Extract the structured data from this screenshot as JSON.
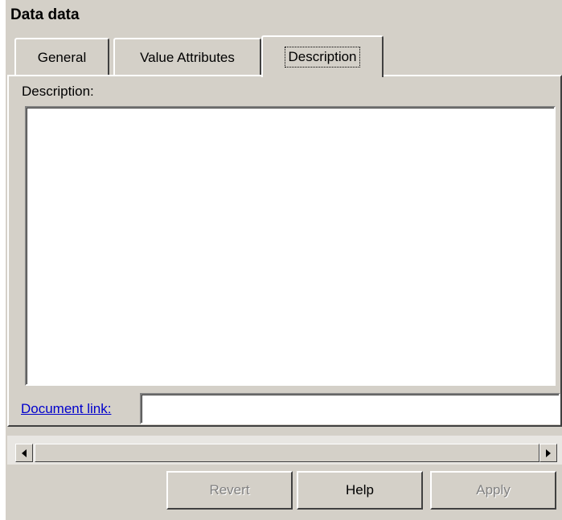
{
  "dialog": {
    "title": "Data data"
  },
  "tabs": [
    {
      "label": "General",
      "active": false
    },
    {
      "label": "Value Attributes",
      "active": false
    },
    {
      "label": "Description",
      "active": true
    }
  ],
  "description": {
    "label": "Description:",
    "value": ""
  },
  "document_link": {
    "label": "Document link:",
    "value": ""
  },
  "buttons": {
    "revert": {
      "label": "Revert",
      "enabled": false
    },
    "help": {
      "label": "Help",
      "enabled": true
    },
    "apply": {
      "label": "Apply",
      "enabled": false
    }
  },
  "colors": {
    "face": "#d4d0c8",
    "link": "#0000cc",
    "disabled_text": "#808080"
  }
}
